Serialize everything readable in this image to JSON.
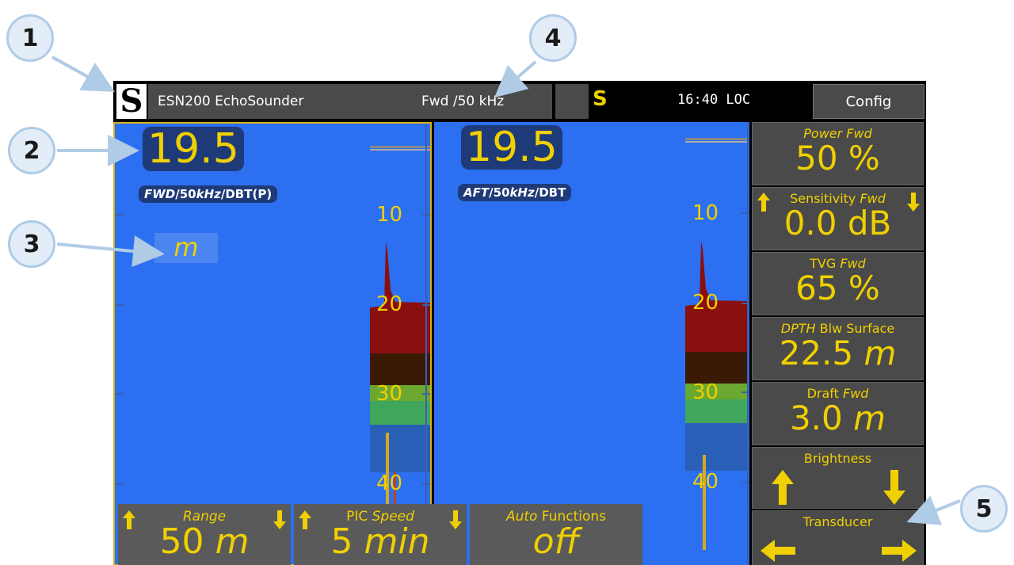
{
  "callouts": [
    "1",
    "2",
    "3",
    "4",
    "5"
  ],
  "topbar": {
    "app_title": "ESN200 EchoSounder",
    "channel": "Fwd /50 kHz",
    "status_letter": "S",
    "clock": "16:40 LOC",
    "config_label": "Config"
  },
  "left_panel": {
    "depth": "19.5",
    "label_italic": "FWD",
    "label_mid": "/50",
    "label_italic2": "kHz",
    "label_rest": "/DBT(P)",
    "unit": "m"
  },
  "right_panel": {
    "depth": "19.5",
    "label_italic": "AFT",
    "label_mid": "/50",
    "label_italic2": "kHz",
    "label_rest": "/DBT"
  },
  "scale_labels": [
    "10",
    "20",
    "30",
    "40"
  ],
  "bottom": {
    "range_label": "Range",
    "range_value": "50",
    "range_unit": "m",
    "pic_label": "PIC",
    "pic_label_italic": "Speed",
    "pic_value": "5",
    "pic_unit": "min",
    "auto_label_italic": "Auto",
    "auto_label": "Functions",
    "auto_value": "off"
  },
  "side": {
    "power_label": "Power Fwd",
    "power_value": "50 %",
    "sens_label": "Sensitivity",
    "sens_label_italic": "Fwd",
    "sens_value": "0.0 dB",
    "tvg_label": "TVG",
    "tvg_label_italic": "Fwd",
    "tvg_value": "65 %",
    "dpth_label_italic": "DPTH",
    "dpth_label": "Blw Surface",
    "dpth_value": "22.5",
    "dpth_unit": "m",
    "draft_label": "Draft",
    "draft_label_italic": "Fwd",
    "draft_value": "3.0",
    "draft_unit": "m",
    "brightness_label": "Brightness",
    "transducer_label": "Transducer"
  },
  "colors": {
    "panel_blue": "#2c6ff0",
    "accent_yellow": "#f0d000",
    "button_gray": "#4a4a4a"
  }
}
